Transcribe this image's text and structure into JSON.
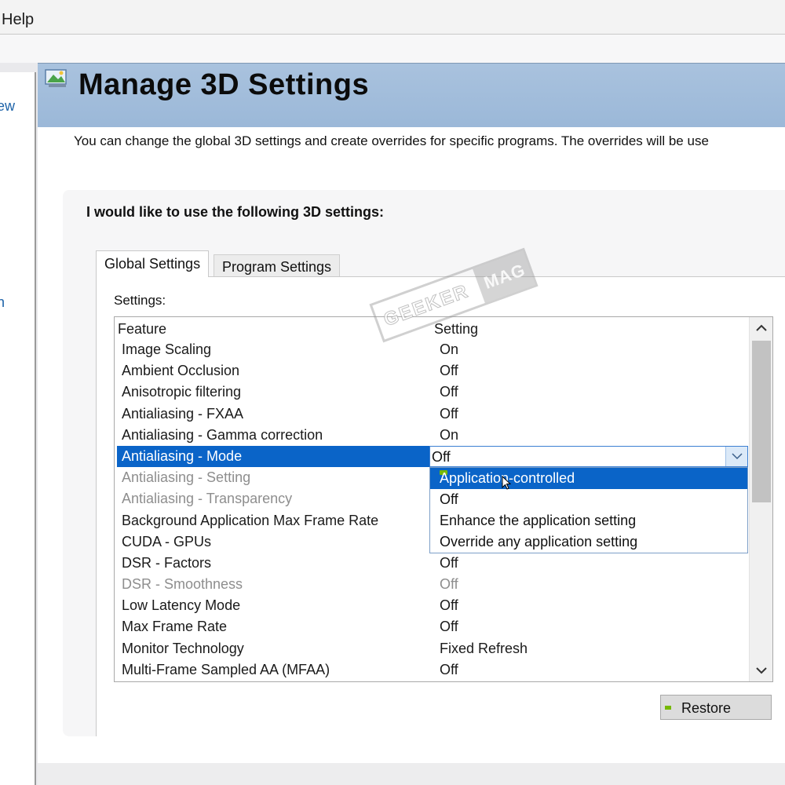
{
  "menubar": {
    "help_label": "Help"
  },
  "nav": {
    "link1_fragment": "iew",
    "link2_fragment": "n"
  },
  "page": {
    "title": "Manage 3D Settings",
    "description": "You can change the global 3D settings and create overrides for specific programs. The overrides will be use"
  },
  "group": {
    "heading": "I would like to use the following 3D settings:"
  },
  "tabs": [
    {
      "label": "Global Settings",
      "active": true
    },
    {
      "label": "Program Settings",
      "active": false
    }
  ],
  "settings_label": "Settings:",
  "table": {
    "columns": [
      "Feature",
      "Setting"
    ],
    "rows": [
      {
        "feature": "Image Scaling",
        "value": "On"
      },
      {
        "feature": "Ambient Occlusion",
        "value": "Off"
      },
      {
        "feature": "Anisotropic filtering",
        "value": "Off"
      },
      {
        "feature": "Antialiasing - FXAA",
        "value": "Off"
      },
      {
        "feature": "Antialiasing - Gamma correction",
        "value": "On"
      },
      {
        "feature": "Antialiasing - Mode",
        "value": "Off",
        "selected": true
      },
      {
        "feature": "Antialiasing - Setting",
        "value": "",
        "disabled": true
      },
      {
        "feature": "Antialiasing - Transparency",
        "value": "",
        "disabled": true
      },
      {
        "feature": "Background Application Max Frame Rate",
        "value": ""
      },
      {
        "feature": "CUDA - GPUs",
        "value": ""
      },
      {
        "feature": "DSR - Factors",
        "value": "Off"
      },
      {
        "feature": "DSR - Smoothness",
        "value": "Off",
        "disabled": true
      },
      {
        "feature": "Low Latency Mode",
        "value": "Off"
      },
      {
        "feature": "Max Frame Rate",
        "value": "Off"
      },
      {
        "feature": "Monitor Technology",
        "value": "Fixed Refresh"
      },
      {
        "feature": "Multi-Frame Sampled AA (MFAA)",
        "value": "Off"
      }
    ]
  },
  "dropdown": {
    "current_value": "Off",
    "options": [
      {
        "label": "Application-controlled",
        "highlighted": true
      },
      {
        "label": "Off"
      },
      {
        "label": "Enhance the application setting"
      },
      {
        "label": "Override any application setting"
      }
    ]
  },
  "restore_label": "Restore",
  "watermark": {
    "left": "GEEKER",
    "right": "MAG"
  },
  "colors": {
    "selection": "#0a64c8",
    "banner": "#a9c2de",
    "nvidia_green": "#76b900",
    "link": "#1c62a8"
  },
  "icons": {
    "banner": "nvidia-3d-settings-icon",
    "combo": "chevron-down-icon",
    "scroll_up": "chevron-up-icon",
    "scroll_down": "chevron-down-icon"
  }
}
